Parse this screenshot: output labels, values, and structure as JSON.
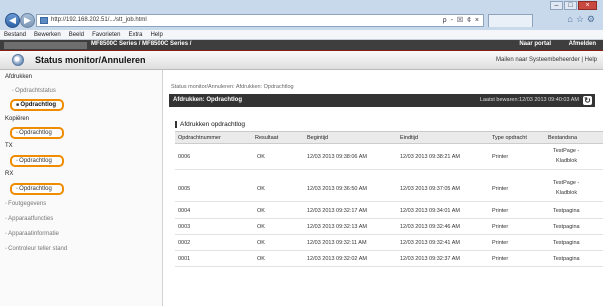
{
  "browser": {
    "url": "http://192.168.202.51/.../stt_job.html",
    "tools": "ρ - ☒ ¢ ×",
    "window_buttons": [
      "–",
      "□",
      "×"
    ],
    "menu": [
      "Bestand",
      "Bewerken",
      "Beeld",
      "Favorieten",
      "Extra",
      "Help"
    ]
  },
  "header": {
    "model": "MF8500C Series / MF8500C Series /",
    "portal_link": "Naar portal",
    "logout_link": "Afmelden",
    "page_title": "Status monitor/Annuleren",
    "mail_link": "Mailen naar Systeembeheerder",
    "help_link": "Help"
  },
  "sidebar": {
    "sections": [
      {
        "label": "Afdrukken",
        "items": [
          {
            "label": "Opdrachtstatus"
          },
          {
            "label": "Opdrachtlog",
            "selected": true
          }
        ]
      },
      {
        "label": "Kopiëren",
        "items": [
          {
            "label": "Opdrachtlog"
          }
        ]
      },
      {
        "label": "TX",
        "items": [
          {
            "label": "Opdrachtlog"
          }
        ]
      },
      {
        "label": "RX",
        "items": [
          {
            "label": "Opdrachtlog"
          }
        ]
      }
    ],
    "extra": [
      "Foutgegevens",
      "Apparaatfuncties",
      "Apparaatinformatie",
      "Controleur teller stand"
    ]
  },
  "main": {
    "breadcrumb": "Status monitor/Annuleren: Afdrukken: Opdrachtlog",
    "bar_title": "Afdrukken: Opdrachtlog",
    "last_updated": "Laatst bewaren:12/03 2013 09:40:03 AM",
    "section_title": "Afdrukken opdrachtlog",
    "columns": [
      "Opdrachtnummer",
      "Resultaat",
      "Begintijd",
      "Eindtijd",
      "Type opdracht",
      "Bestandsna"
    ],
    "rows": [
      {
        "num": "0006",
        "result": "OK",
        "start": "12/03 2013 09:38:06 AM",
        "end": "12/03 2013 09:38:21 AM",
        "type": "Printer",
        "file": [
          "TestPage -",
          "Kladblok"
        ]
      },
      {
        "num": "0005",
        "result": "OK",
        "start": "12/03 2013 09:36:50 AM",
        "end": "12/03 2013 09:37:05 AM",
        "type": "Printer",
        "file": [
          "TestPage -",
          "Kladblok"
        ]
      },
      {
        "num": "0004",
        "result": "OK",
        "start": "12/03 2013 09:32:17 AM",
        "end": "12/03 2013 09:34:01 AM",
        "type": "Printer",
        "file": [
          "Testpagina"
        ]
      },
      {
        "num": "0003",
        "result": "OK",
        "start": "12/03 2013 09:32:13 AM",
        "end": "12/03 2013 09:32:46 AM",
        "type": "Printer",
        "file": [
          "Testpagina"
        ]
      },
      {
        "num": "0002",
        "result": "OK",
        "start": "12/03 2013 09:32:11 AM",
        "end": "12/03 2013 09:32:41 AM",
        "type": "Printer",
        "file": [
          "Testpagina"
        ]
      },
      {
        "num": "0001",
        "result": "OK",
        "start": "12/03 2013 09:32:02 AM",
        "end": "12/03 2013 09:32:37 AM",
        "type": "Printer",
        "file": [
          "Testpagina"
        ]
      }
    ]
  },
  "colors": {
    "highlight": "#f08c00",
    "header_dark": "#3e3e3e",
    "bar": "#333333"
  }
}
